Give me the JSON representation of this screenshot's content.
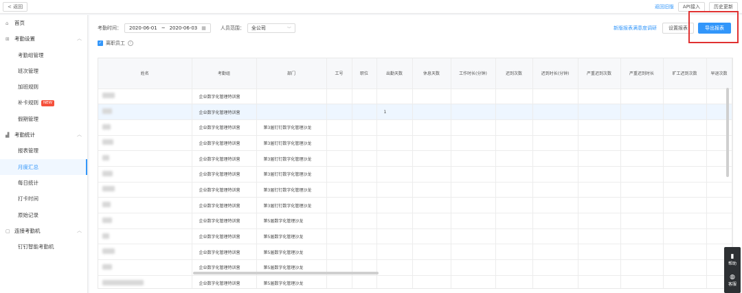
{
  "topbar": {
    "back_label": "< 返回",
    "old_version": "返回旧版",
    "api": "API接入",
    "history": "历史更新"
  },
  "sidebar": {
    "home": "首页",
    "settings_group": "考勤设置",
    "group_mgmt": "考勤组管理",
    "shift_mgmt": "班次管理",
    "overtime": "加班规则",
    "makeup": "补卡规则",
    "new_badge": "NEW",
    "leave": "假期管理",
    "stats_group": "考勤统计",
    "report_mgmt": "报表管理",
    "monthly": "月度汇总",
    "daily": "每日统计",
    "punch_time": "打卡时间",
    "raw_records": "原始记录",
    "device_group": "连接考勤机",
    "device_item": "钉钉智能考勤机"
  },
  "filters": {
    "time_label": "考勤时间：",
    "date_start": "2020-06-01",
    "date_sep": "~",
    "date_end": "2020-06-03",
    "range_label": "人员范围：",
    "range_value": "全公司",
    "resigned_label": "离职员工",
    "survey_link": "新版报表满意度调研",
    "settings_btn": "设置报表",
    "export_btn": "导出报表"
  },
  "table": {
    "headers": [
      "姓名",
      "考勤组",
      "部门",
      "工号",
      "职位",
      "出勤天数",
      "休息天数",
      "工作时长(分钟)",
      "迟到次数",
      "迟到时长(分钟)",
      "严重迟到次数",
      "严重迟到时长",
      "旷工迟到次数",
      "早退次数"
    ],
    "rows": [
      {
        "group": "企业数字化管理特训营",
        "dept": "",
        "attend": ""
      },
      {
        "group": "企业数字化管理特训营",
        "dept": "",
        "attend": "1"
      },
      {
        "group": "企业数字化管理特训营",
        "dept": "第3届钉钉数字化管理沙龙",
        "attend": ""
      },
      {
        "group": "企业数字化管理特训营",
        "dept": "第3届钉钉数字化管理沙龙",
        "attend": ""
      },
      {
        "group": "企业数字化管理特训营",
        "dept": "第3届钉钉数字化管理沙龙",
        "attend": ""
      },
      {
        "group": "企业数字化管理特训营",
        "dept": "第3届钉钉数字化管理沙龙",
        "attend": ""
      },
      {
        "group": "企业数字化管理特训营",
        "dept": "第3届钉钉数字化管理沙龙",
        "attend": ""
      },
      {
        "group": "企业数字化管理特训营",
        "dept": "第3届钉钉数字化管理沙龙",
        "attend": ""
      },
      {
        "group": "企业数字化管理特训营",
        "dept": "第5届数字化管理沙龙",
        "attend": ""
      },
      {
        "group": "企业数字化管理特训营",
        "dept": "第5届数字化管理沙龙",
        "attend": ""
      },
      {
        "group": "企业数字化管理特训营",
        "dept": "第5届数字化管理沙龙",
        "attend": ""
      },
      {
        "group": "企业数字化管理特训营",
        "dept": "第5届数字化管理沙龙",
        "attend": ""
      },
      {
        "group": "企业数字化管理特训营",
        "dept": "第5届数字化管理沙龙",
        "attend": ""
      }
    ]
  },
  "float": {
    "help": "帮助",
    "service": "客服"
  }
}
